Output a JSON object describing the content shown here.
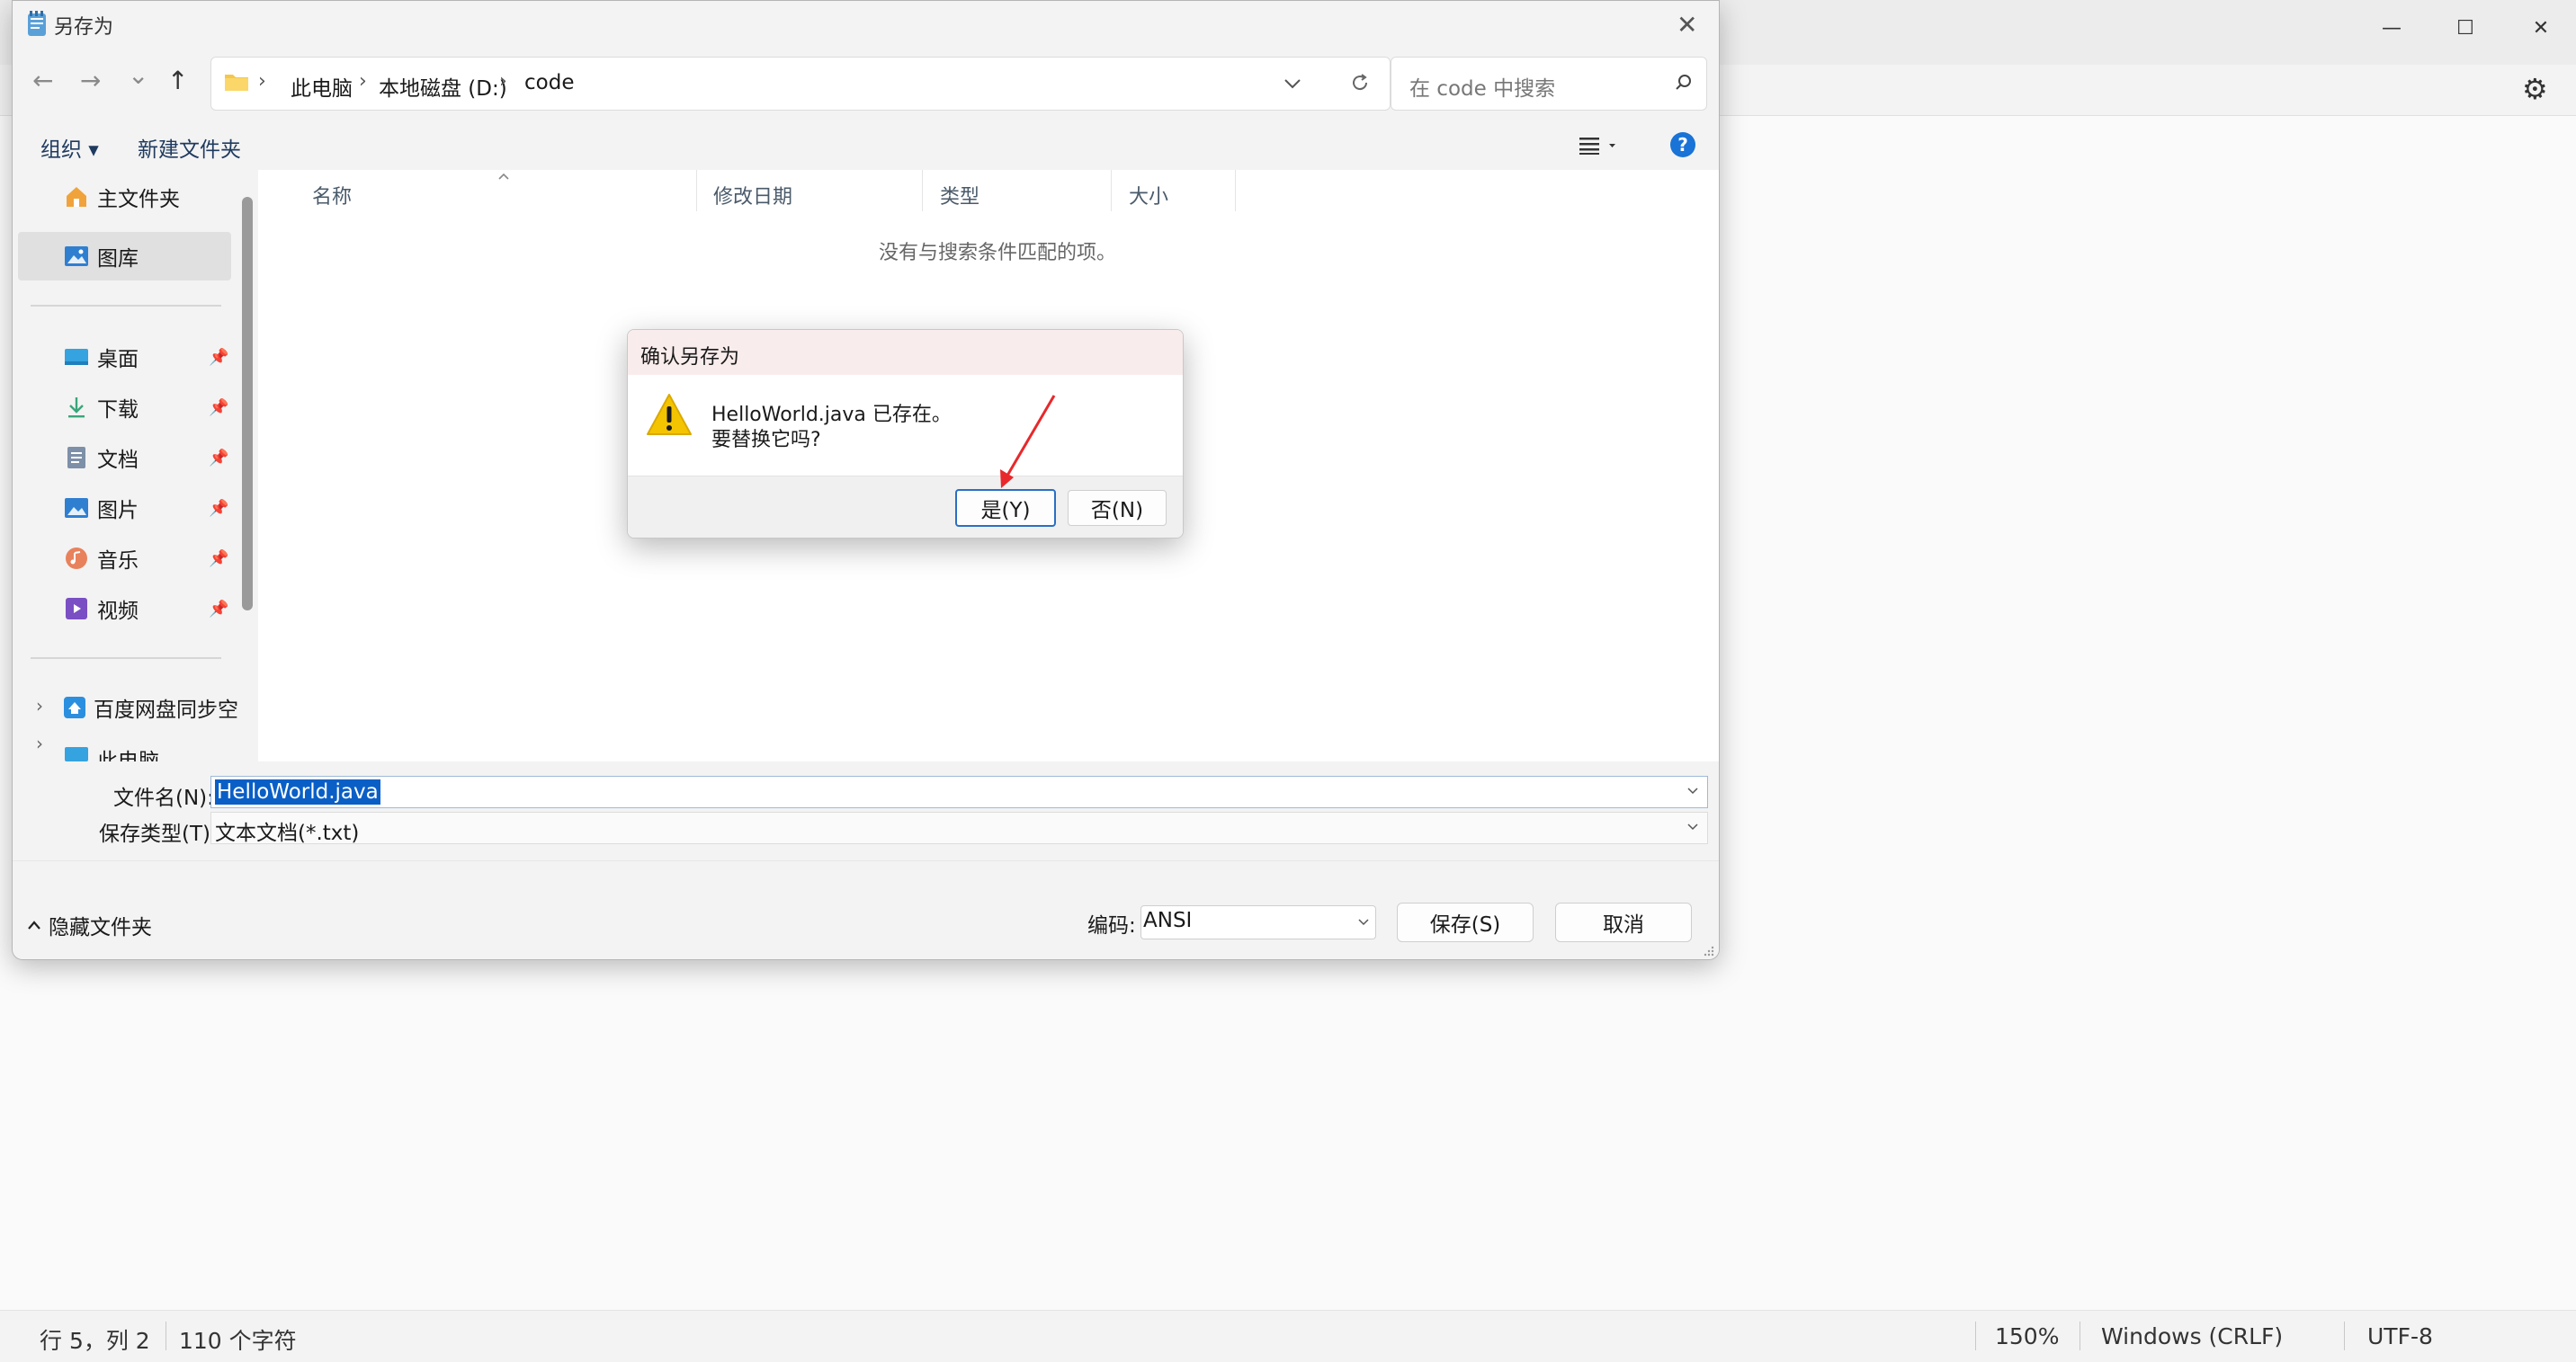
{
  "notepad": {
    "window_controls": {
      "minimize": "—",
      "maximize": "☐",
      "close": "✕"
    },
    "settings_icon": "⚙",
    "status": {
      "position": "行 5，列 2",
      "chars": "110 个字符",
      "zoom": "150%",
      "line_ending": "Windows (CRLF)",
      "encoding": "UTF-8"
    }
  },
  "save_dialog": {
    "title": "另存为",
    "close": "✕",
    "nav": {
      "back": "←",
      "forward": "→",
      "recent": "⌄",
      "up": "↑"
    },
    "breadcrumb": [
      "此电脑",
      "本地磁盘 (D:)",
      "code"
    ],
    "search_placeholder": "在 code 中搜索",
    "commands": {
      "organize": "组织 ▾",
      "new_folder": "新建文件夹",
      "help": "?"
    },
    "nav_pane": {
      "quick": [
        {
          "label": "主文件夹"
        },
        {
          "label": "图库"
        }
      ],
      "pinned": [
        {
          "label": "桌面"
        },
        {
          "label": "下载"
        },
        {
          "label": "文档"
        },
        {
          "label": "图片"
        },
        {
          "label": "音乐"
        },
        {
          "label": "视频"
        }
      ],
      "drives": [
        {
          "label": "百度网盘同步空间"
        },
        {
          "label": "此电脑"
        }
      ]
    },
    "columns": [
      "名称",
      "修改日期",
      "类型",
      "大小"
    ],
    "empty_message": "没有与搜索条件匹配的项。",
    "filename_label": "文件名(N):",
    "filename_value": "HelloWorld.java",
    "filetype_label": "保存类型(T):",
    "filetype_value": "文本文档(*.txt)",
    "hide_folders": "隐藏文件夹",
    "encoding_label": "编码:",
    "encoding_value": "ANSI",
    "save_button": "保存(S)",
    "cancel_button": "取消"
  },
  "confirm_dialog": {
    "title": "确认另存为",
    "line1": "HelloWorld.java 已存在。",
    "line2": "要替换它吗?",
    "yes_button": "是(Y)",
    "no_button": "否(N)"
  },
  "colors": {
    "accent": "#0a5fc6",
    "annotation_arrow": "#e8282b",
    "warning": "#f5c400"
  }
}
